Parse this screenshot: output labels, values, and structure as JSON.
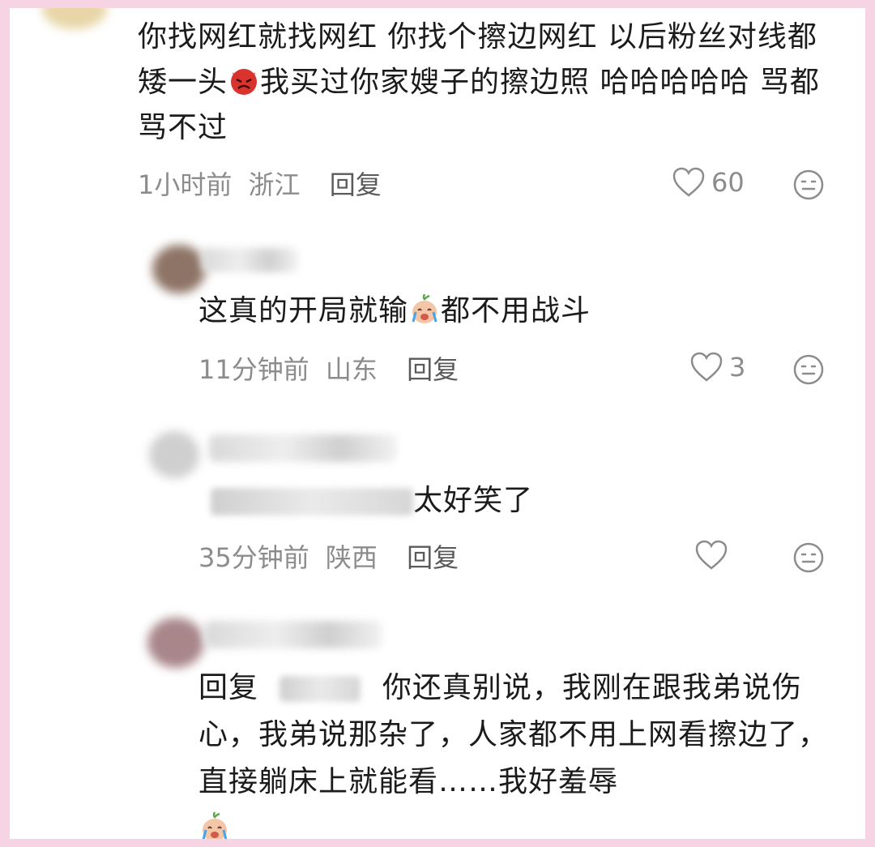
{
  "comments": [
    {
      "text": "你找网红就找网红 你找个擦边网红 以后粉丝对线都矮一头",
      "text_after_emoji": "我买过你家嫂子的擦边照 哈哈哈哈哈 骂都骂不过",
      "emoji": "angry-devil-emoji",
      "time": "1小时前",
      "location": "浙江",
      "reply_label": "回复",
      "likes": "60"
    },
    {
      "text": "这真的开局就输",
      "text_after_emoji": "都不用战斗",
      "emoji": "crying-face-emoji",
      "time": "11分钟前",
      "location": "山东",
      "reply_label": "回复",
      "likes": "3"
    },
    {
      "text": "太好笑了",
      "time": "35分钟前",
      "location": "陕西",
      "reply_label": "回复",
      "likes": ""
    },
    {
      "reply_prefix": "回复",
      "text": "你还真别说，我刚在跟我弟说伤心，我弟说那杂了，人家都不用上网看擦边了，直接躺床上就能看……我好羞辱",
      "emoji": "crying-face-emoji"
    }
  ],
  "colors": {
    "frame": "#f7d4e3",
    "text": "#1b1b1b",
    "meta": "#8c8c8c"
  }
}
